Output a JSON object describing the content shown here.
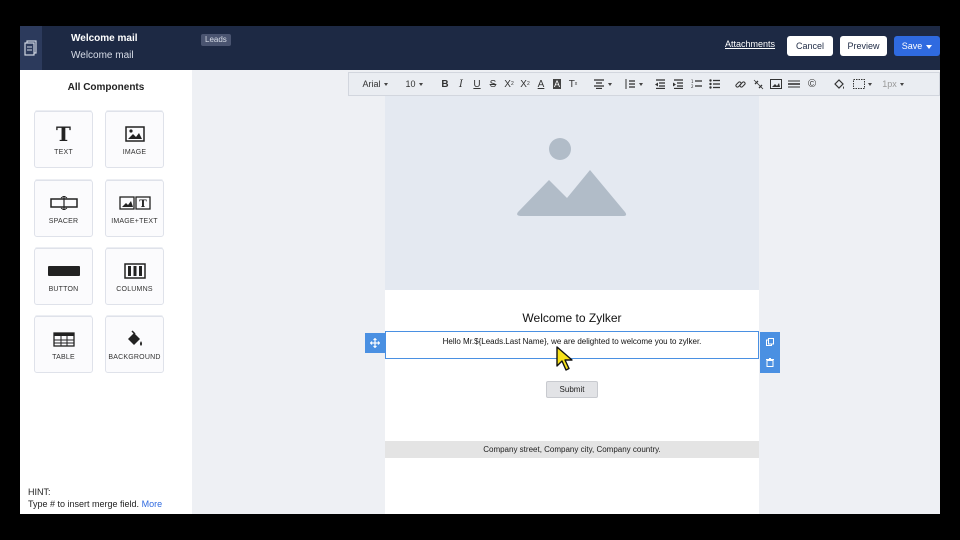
{
  "header": {
    "title": "Welcome mail",
    "subtitle": "Welcome mail",
    "module": "Leads",
    "attachments_label": "Attachments",
    "cancel_label": "Cancel",
    "preview_label": "Preview",
    "save_label": "Save",
    "accent_color": "#2f6ae0",
    "background_color": "#1d2944"
  },
  "sidebar": {
    "title": "All Components",
    "components": [
      {
        "label": "TEXT",
        "icon": "text-icon"
      },
      {
        "label": "IMAGE",
        "icon": "image-icon"
      },
      {
        "label": "SPACER",
        "icon": "spacer-icon"
      },
      {
        "label": "IMAGE+TEXT",
        "icon": "image-text-icon"
      },
      {
        "label": "BUTTON",
        "icon": "button-icon"
      },
      {
        "label": "COLUMNS",
        "icon": "columns-icon"
      },
      {
        "label": "TABLE",
        "icon": "table-icon"
      },
      {
        "label": "BACKGROUND",
        "icon": "paint-bucket-icon"
      }
    ],
    "hint_label": "HINT:",
    "hint_text": "Type # to insert merge field.",
    "hint_more": "More"
  },
  "toolbar": {
    "font_family": "Arial",
    "font_size": "10",
    "border_width": "1px"
  },
  "email": {
    "headline": "Welcome to Zylker",
    "body": "Hello Mr.${Leads.Last Name}, we are delighted to welcome you to zylker.",
    "button_label": "Submit",
    "footer": "Company street, Company city, Company country."
  }
}
